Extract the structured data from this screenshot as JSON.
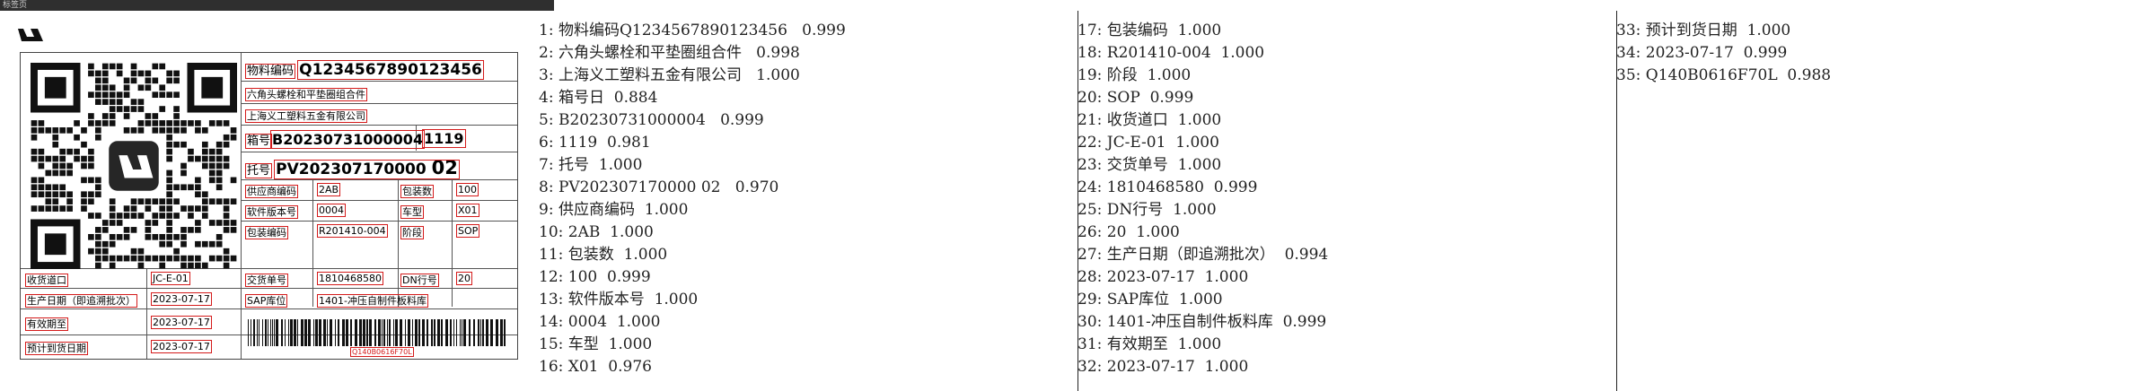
{
  "window": {
    "title": "标签页"
  },
  "label": {
    "material_code_label": "物料编码",
    "material_code_value": "Q1234567890123456",
    "part_name": "六角头螺栓和平垫圈组合件",
    "supplier_name": "上海义工塑料五金有限公司",
    "box_no_label": "箱号",
    "box_no_value": "B20230731000004",
    "qty_big": "1119",
    "pallet_no_label": "托号",
    "pallet_no_value": "PV202307170000",
    "pallet_no_suffix": "02",
    "supplier_code_label": "供应商编码",
    "supplier_code_value": "2AB",
    "pack_qty_label": "包装数",
    "pack_qty_value": "100",
    "software_ver_label": "软件版本号",
    "software_ver_value": "0004",
    "car_model_label": "车型",
    "car_model_value": "X01",
    "pack_code_label": "包装编码",
    "pack_code_value": "R201410-004",
    "stage_label": "阶段",
    "stage_value": "SOP",
    "receiving_label": "收货道口",
    "receiving_value": "JC-E-01",
    "delivery_no_label": "交货单号",
    "delivery_no_value": "1810468580",
    "dn_label": "DN行号",
    "dn_value": "20",
    "production_date_label": "生产日期（即追溯批次）",
    "production_date_value": "2023-07-17",
    "sap_label": "SAP库位",
    "sap_value": "1401-冲压自制件板料库",
    "expiry_label": "有效期至",
    "expiry_value": "2023-07-17",
    "arrival_label": "预计到货日期",
    "arrival_value": "2023-07-17",
    "barcode_text": "Q140B0616F70L"
  },
  "ocr_results": [
    "1: 物料编码Q1234567890123456   0.999",
    "2: 六角头螺栓和平垫圈组合件   0.998",
    "3: 上海义工塑料五金有限公司   1.000",
    "4: 箱号日  0.884",
    "5: B20230731000004   0.999",
    "6: 1119  0.981",
    "7: 托号  1.000",
    "8: PV202307170000 02   0.970",
    "9: 供应商编码  1.000",
    "10: 2AB  1.000",
    "11: 包装数  1.000",
    "12: 100  0.999",
    "13: 软件版本号  1.000",
    "14: 0004  1.000",
    "15: 车型  1.000",
    "16: X01  0.976",
    "17: 包装编码  1.000",
    "18: R201410-004  1.000",
    "19: 阶段  1.000",
    "20: SOP  0.999",
    "21: 收货道口  1.000",
    "22: JC-E-01  1.000",
    "23: 交货单号  1.000",
    "24: 1810468580  0.999",
    "25: DN行号  1.000",
    "26: 20  1.000",
    "27: 生产日期（即追溯批次）  0.994",
    "28: 2023-07-17  1.000",
    "29: SAP库位  1.000",
    "30: 1401-冲压自制件板料库  0.999",
    "31: 有效期至  1.000",
    "32: 2023-07-17  1.000",
    "33: 预计到货日期  1.000",
    "34: 2023-07-17  0.999",
    "35: Q140B0616F70L  0.988"
  ]
}
